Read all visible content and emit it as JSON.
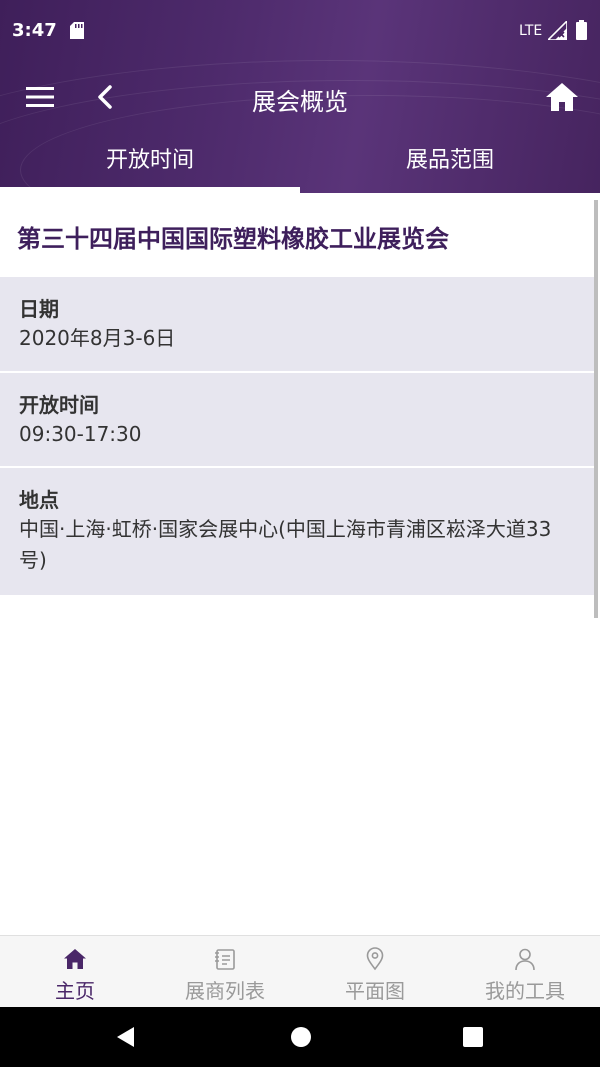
{
  "status_bar": {
    "time": "3:47",
    "network": "LTE"
  },
  "app_bar": {
    "title": "展会概览"
  },
  "tabs": [
    {
      "label": "开放时间",
      "active": true
    },
    {
      "label": "展品范围",
      "active": false
    }
  ],
  "expo": {
    "title": "第三十四届中国国际塑料橡胶工业展览会",
    "details": [
      {
        "label": "日期",
        "value": "2020年8月3-6日"
      },
      {
        "label": "开放时间",
        "value": "09:30-17:30"
      },
      {
        "label": "地点",
        "value": "中国·上海·虹桥·国家会展中心(中国上海市青浦区崧泽大道33号)"
      }
    ]
  },
  "bottom_nav": [
    {
      "label": "主页",
      "icon": "home-icon",
      "active": true
    },
    {
      "label": "展商列表",
      "icon": "list-icon",
      "active": false
    },
    {
      "label": "平面图",
      "icon": "location-pin-icon",
      "active": false
    },
    {
      "label": "我的工具",
      "icon": "person-icon",
      "active": false
    }
  ],
  "colors": {
    "brand_purple": "#4a2768",
    "card_bg": "#e7e6ef",
    "inactive_nav": "#9a9a9a"
  }
}
